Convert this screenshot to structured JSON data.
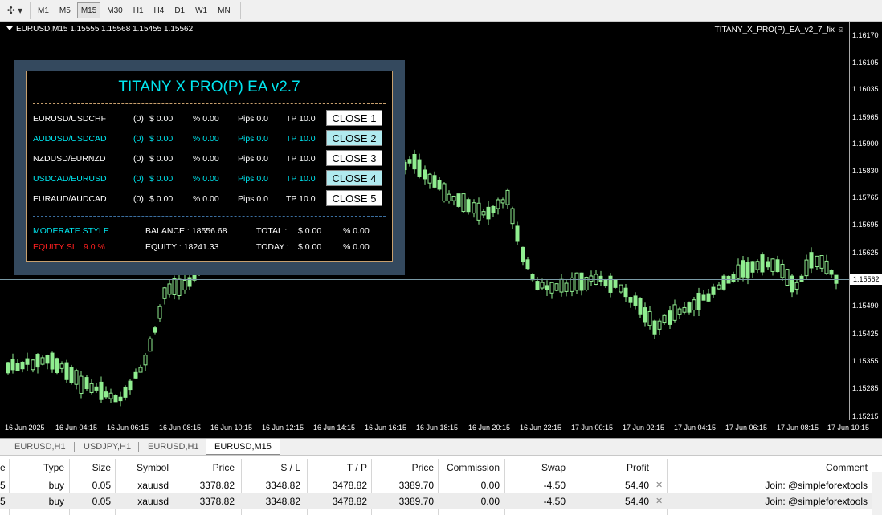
{
  "toolbar": {
    "tool_icon": "crosshair-dropdown-icon",
    "timeframes": [
      "M1",
      "M5",
      "M15",
      "M30",
      "H1",
      "H4",
      "D1",
      "W1",
      "MN"
    ],
    "active_timeframe": "M15"
  },
  "chart": {
    "info": "EURUSD,M15  1.15555 1.15568 1.15455 1.15562",
    "ea_name": "TITANY_X_PRO(P)_EA_v2_7_fix",
    "ea_icon": "smiley-icon",
    "bullish_color": "#90ee90",
    "background_color": "#000000",
    "current_price": "1.15562",
    "price_levels": [
      "1.16170",
      "1.16105",
      "1.16035",
      "1.15965",
      "1.15900",
      "1.15830",
      "1.15765",
      "1.15695",
      "1.15625",
      "1.15490",
      "1.15425",
      "1.15355",
      "1.15285",
      "1.15215"
    ],
    "time_labels": [
      "16 Jun 2025",
      "16 Jun 04:15",
      "16 Jun 06:15",
      "16 Jun 08:15",
      "16 Jun 10:15",
      "16 Jun 12:15",
      "16 Jun 14:15",
      "16 Jun 16:15",
      "16 Jun 18:15",
      "16 Jun 20:15",
      "16 Jun 22:15",
      "17 Jun 00:15",
      "17 Jun 02:15",
      "17 Jun 04:15",
      "17 Jun 06:15",
      "17 Jun 08:15",
      "17 Jun 10:15"
    ]
  },
  "ea_panel": {
    "title": "TITANY X PRO(P) EA v2.7",
    "pairs": [
      {
        "pair": "EURUSD/USDCHF",
        "count": "(0)",
        "profit": "$ 0.00",
        "percent": "% 0.00",
        "pips": "Pips 0.0",
        "tp": "TP 10.0",
        "button": "CLOSE 1",
        "highlight": false
      },
      {
        "pair": "AUDUSD/USDCAD",
        "count": "(0)",
        "profit": "$ 0.00",
        "percent": "% 0.00",
        "pips": "Pips 0.0",
        "tp": "TP 10.0",
        "button": "CLOSE 2",
        "highlight": true
      },
      {
        "pair": "NZDUSD/EURNZD",
        "count": "(0)",
        "profit": "$ 0.00",
        "percent": "% 0.00",
        "pips": "Pips 0.0",
        "tp": "TP 10.0",
        "button": "CLOSE 3",
        "highlight": false
      },
      {
        "pair": "USDCAD/EURUSD",
        "count": "(0)",
        "profit": "$ 0.00",
        "percent": "% 0.00",
        "pips": "Pips 0.0",
        "tp": "TP 10.0",
        "button": "CLOSE 4",
        "highlight": true
      },
      {
        "pair": "EURAUD/AUDCAD",
        "count": "(0)",
        "profit": "$ 0.00",
        "percent": "% 0.00",
        "pips": "Pips 0.0",
        "tp": "TP 10.0",
        "button": "CLOSE 5",
        "highlight": false
      }
    ],
    "style": "MODERATE STYLE",
    "equity_sl": "EQUITY SL : 9.0 %",
    "balance": "BALANCE : 18556.68",
    "equity": "EQUITY : 18241.33",
    "total_label": "TOTAL :",
    "total_value": "$ 0.00",
    "total_percent": "% 0.00",
    "today_label": "TODAY :",
    "today_value": "$ 0.00",
    "today_percent": "% 0.00",
    "title_color": "#00e5ee",
    "sl_color": "#ff2020"
  },
  "tabs": [
    "EURUSD,H1",
    "USDJPY,H1",
    "EURUSD,H1",
    "EURUSD,M15"
  ],
  "active_tab": 3,
  "table": {
    "headers": [
      "e",
      "Type",
      "Size",
      "Symbol",
      "Price",
      "S / L",
      "T / P",
      "Price",
      "Commission",
      "Swap",
      "Profit",
      "Comment"
    ],
    "rows": [
      [
        "5",
        "buy",
        "0.05",
        "xauusd",
        "3378.82",
        "3348.82",
        "3478.82",
        "3389.70",
        "0.00",
        "-4.50",
        "54.40",
        "Join: @simpleforextools"
      ],
      [
        "5",
        "buy",
        "0.05",
        "xauusd",
        "3378.82",
        "3348.82",
        "3478.82",
        "3389.70",
        "0.00",
        "-4.50",
        "54.40",
        "Join: @simpleforextools"
      ]
    ],
    "close_icon": "close-x-icon"
  }
}
